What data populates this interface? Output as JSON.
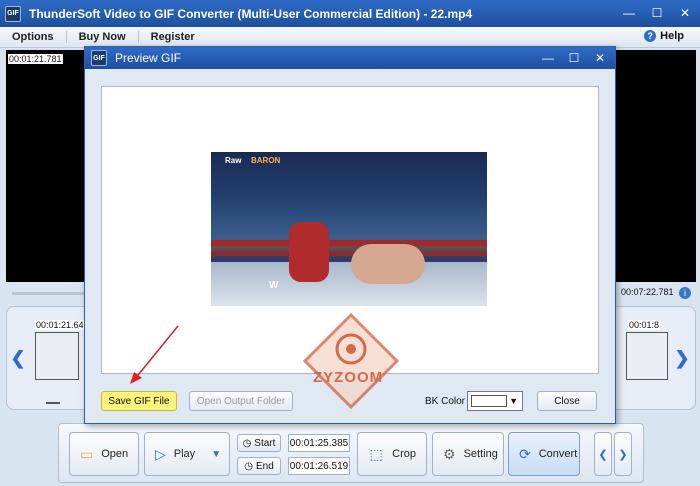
{
  "window": {
    "app_icon": "GIF",
    "title": "ThunderSoft Video to GIF Converter (Multi-User Commercial Edition) - 22.mp4",
    "minimize": "—",
    "maximize": "☐",
    "close": "✕"
  },
  "menu": {
    "items": [
      "Options",
      "Buy Now",
      "Register"
    ],
    "help": "Help"
  },
  "player": {
    "current_time": "00:01:21.781",
    "total_time": "00:07:22.781"
  },
  "thumbnails": {
    "left_time": "00:01:21.64",
    "right_time": "00:01:8"
  },
  "toolbar": {
    "open": "Open",
    "play": "Play",
    "start_label": "Start",
    "end_label": "End",
    "start_time": "00:01:25.385",
    "end_time": "00:01:26.519",
    "crop": "Crop",
    "setting": "Setting",
    "convert": "Convert"
  },
  "dialog": {
    "title": "Preview GIF",
    "save_label": "Save GIF File",
    "open_folder_label": "Open Output Folder",
    "bk_color_label": "BK Color",
    "bk_color_value": "#ffffff",
    "close_label": "Close"
  },
  "preview": {
    "watermark_text": "ZYZOOM",
    "logo_left": "Raw",
    "logo_brand": "BARON",
    "ring_logo": "W"
  },
  "colors": {
    "titlebar": "#2f6cc7",
    "save_button": "#fbf27a",
    "annotation_arrow": "#e02020",
    "watermark": "#d46a4a"
  }
}
